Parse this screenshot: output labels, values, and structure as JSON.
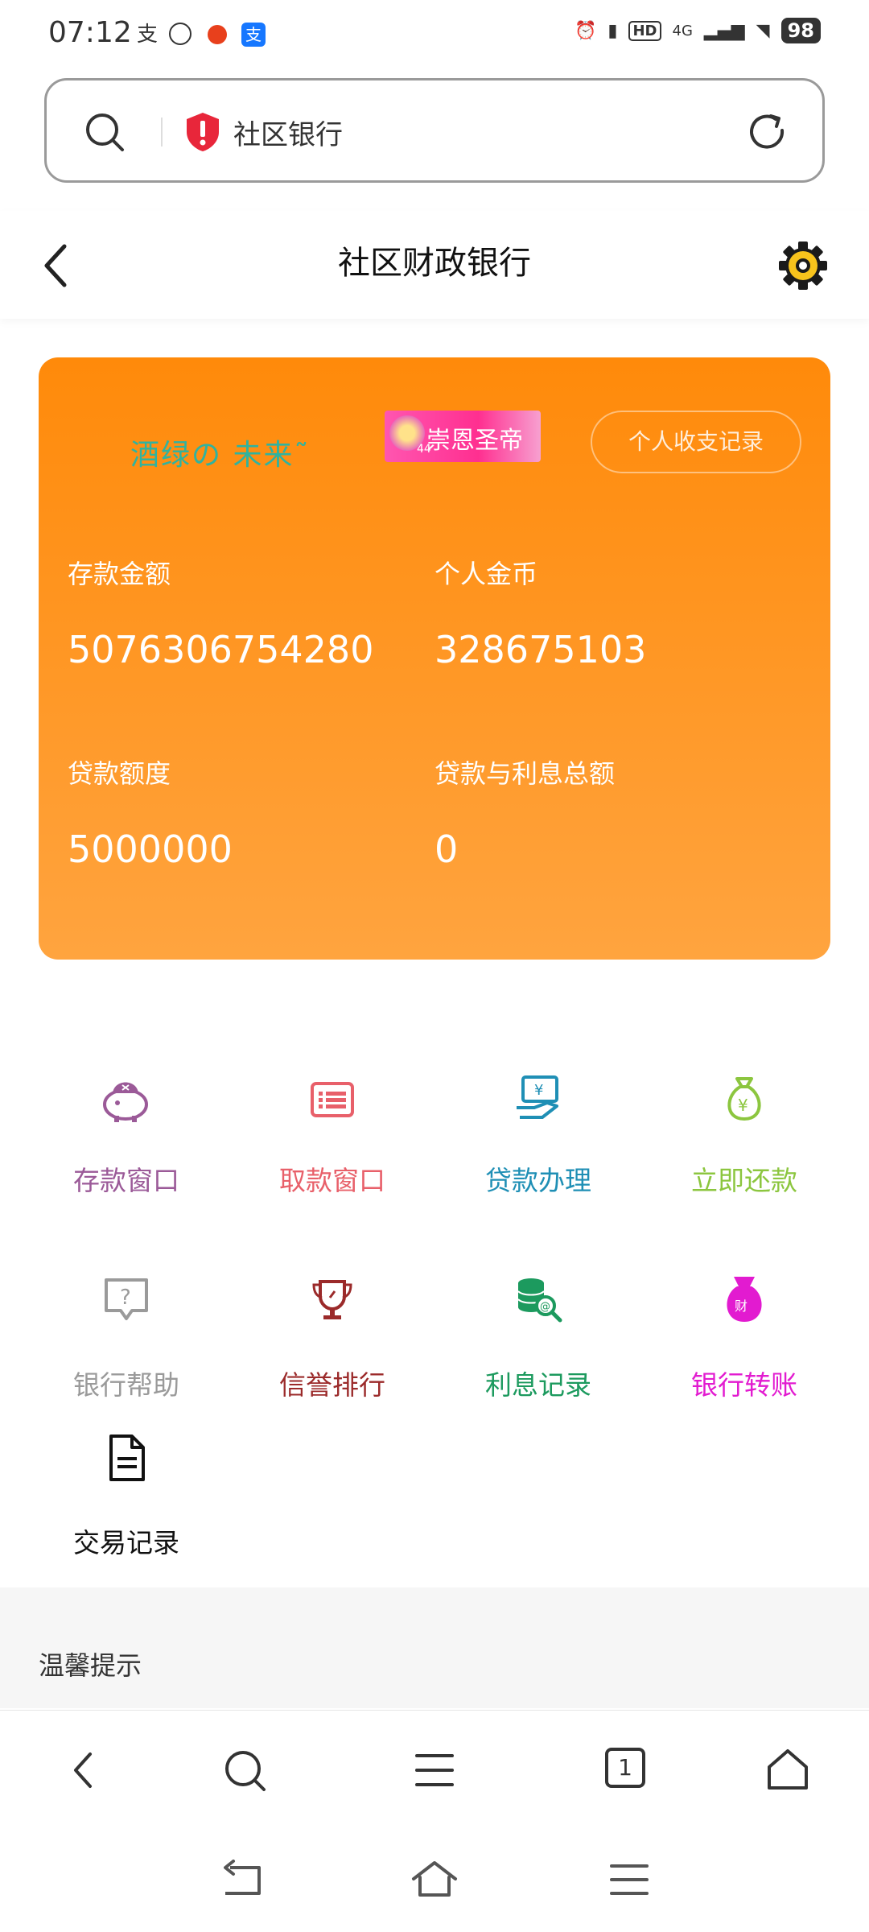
{
  "status_bar": {
    "time": "07:12",
    "battery": "98",
    "network": "4G"
  },
  "browser": {
    "url_text": "社区银行",
    "tab_count": "1"
  },
  "page": {
    "title": "社区财政银行"
  },
  "card": {
    "user_name": "酒绿の 未来˜",
    "badge_text": "崇恩圣帝",
    "badge_num": "44",
    "record_button": "个人收支记录",
    "stats": [
      {
        "label": "存款金额",
        "value": "5076306754280"
      },
      {
        "label": "个人金币",
        "value": "328675103"
      },
      {
        "label": "贷款额度",
        "value": "5000000"
      },
      {
        "label": "贷款与利息总额",
        "value": "0"
      }
    ]
  },
  "menu": {
    "items": [
      {
        "label": "存款窗口",
        "icon": "piggy-bank-icon",
        "color": "#9b5a98"
      },
      {
        "label": "取款窗口",
        "icon": "list-card-icon",
        "color": "#e8606a"
      },
      {
        "label": "贷款办理",
        "icon": "loan-hand-icon",
        "color": "#1f8fb5"
      },
      {
        "label": "立即还款",
        "icon": "money-bag-icon",
        "color": "#8cc63f"
      },
      {
        "label": "银行帮助",
        "icon": "help-bubble-icon",
        "color": "#9a9a9a"
      },
      {
        "label": "信誉排行",
        "icon": "trophy-icon",
        "color": "#9b2a2a"
      },
      {
        "label": "利息记录",
        "icon": "coins-search-icon",
        "color": "#1c9a5e"
      },
      {
        "label": "银行转账",
        "icon": "fortune-bag-icon",
        "color": "#e21bd0"
      },
      {
        "label": "交易记录",
        "icon": "document-icon",
        "color": "#111111"
      }
    ]
  },
  "tips": {
    "title": "温馨提示"
  }
}
